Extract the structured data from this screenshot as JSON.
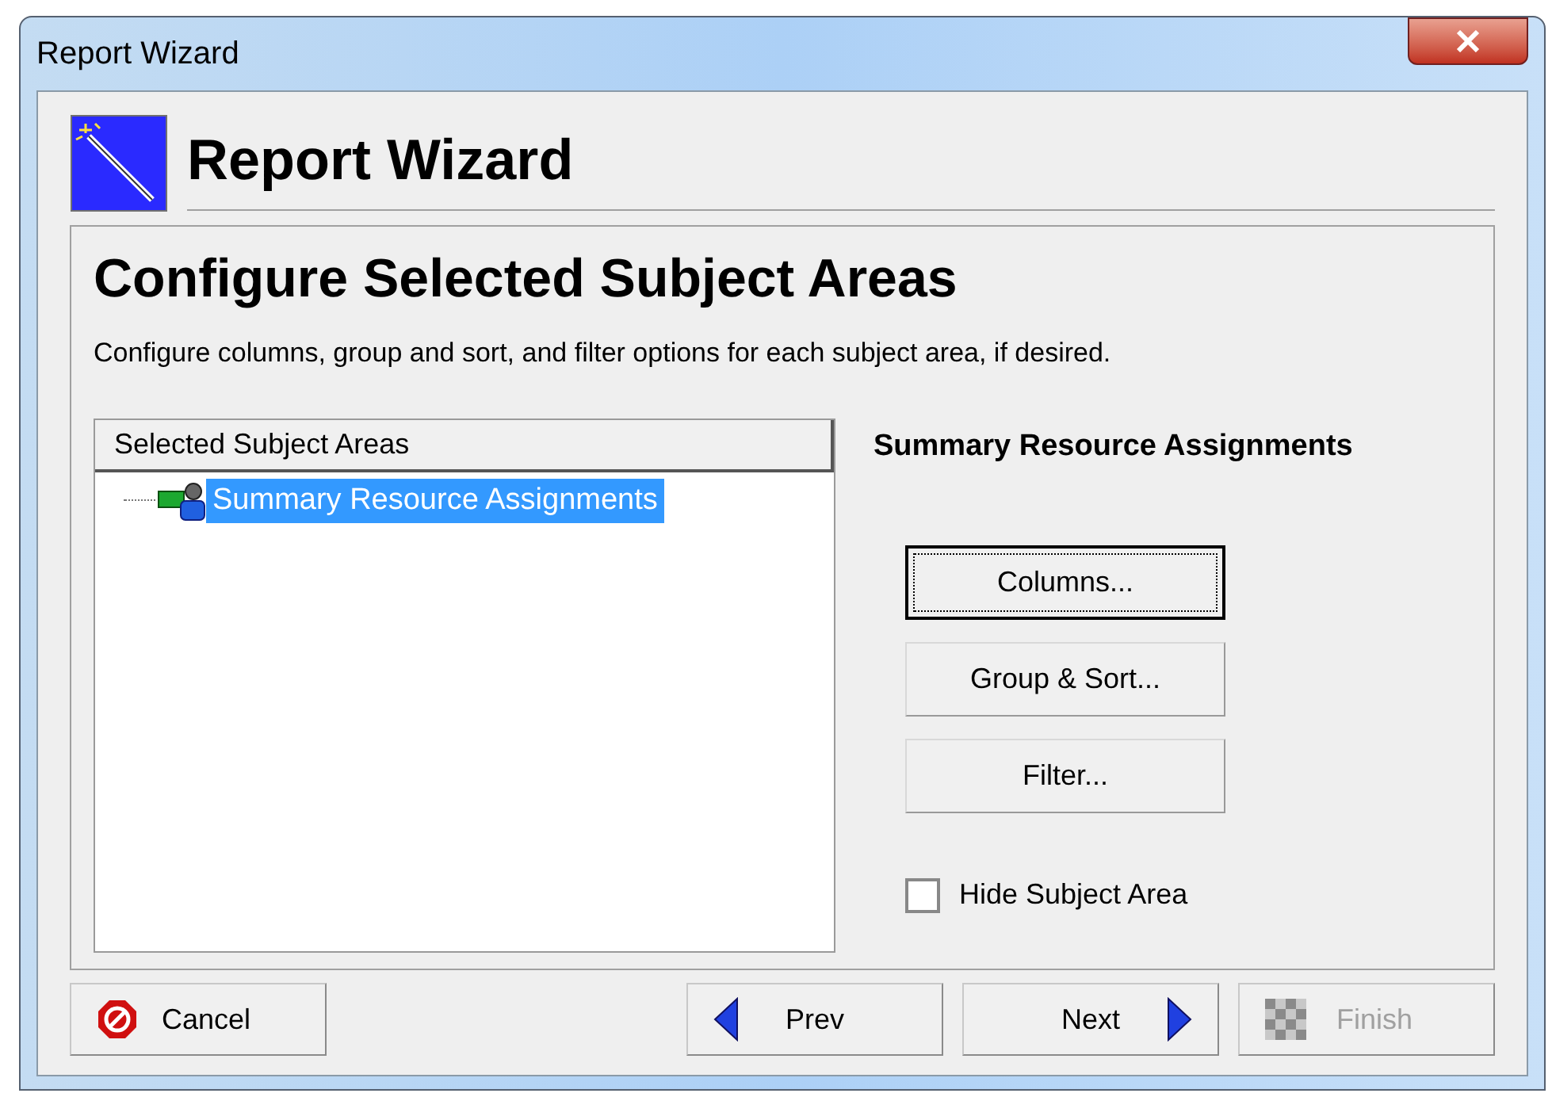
{
  "window": {
    "title": "Report Wizard"
  },
  "header": {
    "title": "Report Wizard"
  },
  "page": {
    "title": "Configure Selected Subject Areas",
    "description": "Configure columns, group and sort, and filter options for each subject area, if desired."
  },
  "tree": {
    "heading": "Selected Subject Areas",
    "items": [
      {
        "label": "Summary Resource Assignments",
        "selected": true
      }
    ]
  },
  "details": {
    "title": "Summary Resource Assignments",
    "buttons": [
      {
        "label": "Columns...",
        "focused": true
      },
      {
        "label": "Group & Sort...",
        "focused": false
      },
      {
        "label": "Filter...",
        "focused": false
      }
    ],
    "hide_checkbox": {
      "label": "Hide Subject Area",
      "checked": false
    }
  },
  "footer": [
    {
      "kind": "cancel",
      "label": "Cancel",
      "disabled": false
    },
    {
      "kind": "prev",
      "label": "Prev",
      "disabled": false
    },
    {
      "kind": "next",
      "label": "Next",
      "disabled": false
    },
    {
      "kind": "finish",
      "label": "Finish",
      "disabled": true
    }
  ]
}
